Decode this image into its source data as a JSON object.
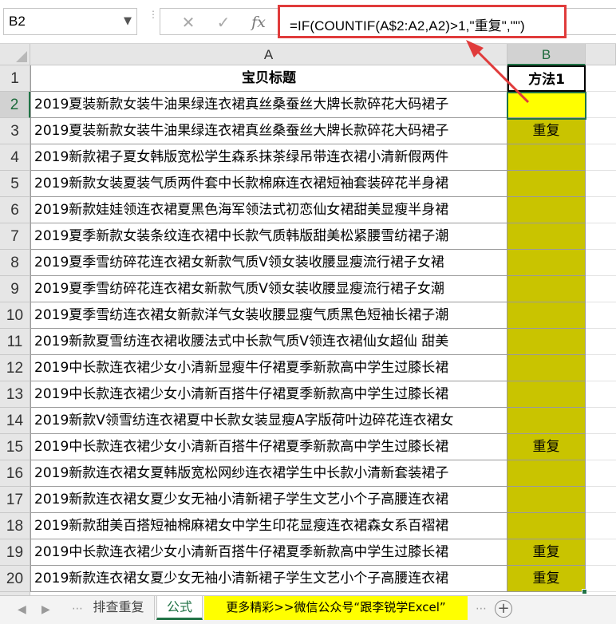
{
  "formula_bar": {
    "name_box": "B2",
    "formula": "=IF(COUNTIF(A$2:A2,A2)>1,\"重复\",\"\")",
    "fx_label": "fx",
    "cancel_glyph": "✕",
    "enter_glyph": "✓"
  },
  "columns": [
    "A",
    "B"
  ],
  "header_row": {
    "num": "1",
    "a": "宝贝标题",
    "b": "方法1"
  },
  "rows": [
    {
      "num": "2",
      "a": "2019夏装新款女装牛油果绿连衣裙真丝桑蚕丝大牌长款碎花大码裙子",
      "b": ""
    },
    {
      "num": "3",
      "a": "2019夏装新款女装牛油果绿连衣裙真丝桑蚕丝大牌长款碎花大码裙子",
      "b": "重复"
    },
    {
      "num": "4",
      "a": "2019新款裙子夏女韩版宽松学生森系抹茶绿吊带连衣裙小清新假两件",
      "b": ""
    },
    {
      "num": "5",
      "a": "2019新款女装夏装气质两件套中长款棉麻连衣裙短袖套装碎花半身裙",
      "b": ""
    },
    {
      "num": "6",
      "a": "2019新款娃娃领连衣裙夏黑色海军领法式初恋仙女裙甜美显瘦半身裙",
      "b": ""
    },
    {
      "num": "7",
      "a": "2019夏季新款女装条纹连衣裙中长款气质韩版甜美松紧腰雪纺裙子潮",
      "b": ""
    },
    {
      "num": "8",
      "a": "2019夏季雪纺碎花连衣裙女新款气质V领女装收腰显瘦流行裙子女裙",
      "b": ""
    },
    {
      "num": "9",
      "a": "2019夏季雪纺碎花连衣裙女新款气质V领女装收腰显瘦流行裙子女潮",
      "b": ""
    },
    {
      "num": "10",
      "a": "2019夏季雪纺连衣裙女新款洋气女装收腰显瘦气质黑色短袖长裙子潮",
      "b": ""
    },
    {
      "num": "11",
      "a": "2019新款夏雪纺连衣裙收腰法式中长款气质V领连衣裙仙女超仙 甜美",
      "b": ""
    },
    {
      "num": "12",
      "a": "2019中长款连衣裙少女小清新显瘦牛仔裙夏季新款高中学生过膝长裙",
      "b": ""
    },
    {
      "num": "13",
      "a": "2019中长款连衣裙少女小清新百搭牛仔裙夏季新款高中学生过膝长裙",
      "b": ""
    },
    {
      "num": "14",
      "a": "2019新款V领雪纺连衣裙夏中长款女装显瘦A字版荷叶边碎花连衣裙女",
      "b": ""
    },
    {
      "num": "15",
      "a": "2019中长款连衣裙少女小清新百搭牛仔裙夏季新款高中学生过膝长裙",
      "b": "重复"
    },
    {
      "num": "16",
      "a": "2019新款连衣裙女夏韩版宽松网纱连衣裙学生中长款小清新套装裙子",
      "b": ""
    },
    {
      "num": "17",
      "a": "2019新款连衣裙女夏少女无袖小清新裙子学生文艺小个子高腰连衣裙",
      "b": ""
    },
    {
      "num": "18",
      "a": "2019新款甜美百搭短袖棉麻裙女中学生印花显瘦连衣裙森女系百褶裙",
      "b": ""
    },
    {
      "num": "19",
      "a": "2019中长款连衣裙少女小清新百搭牛仔裙夏季新款高中学生过膝长裙",
      "b": "重复"
    },
    {
      "num": "20",
      "a": "2019新款连衣裙女夏少女无袖小清新裙子学生文艺小个子高腰连衣裙",
      "b": "重复"
    }
  ],
  "sheet_tabs": {
    "tabs": [
      "排查重复",
      "公式",
      "更多精彩>>微信公众号“跟李锐学Excel”"
    ],
    "active": "公式"
  },
  "colors": {
    "highlight_yellow": "#ffff00",
    "olive_fill": "#c9c400",
    "annotation_red": "#e03b3b",
    "excel_green": "#217346"
  }
}
